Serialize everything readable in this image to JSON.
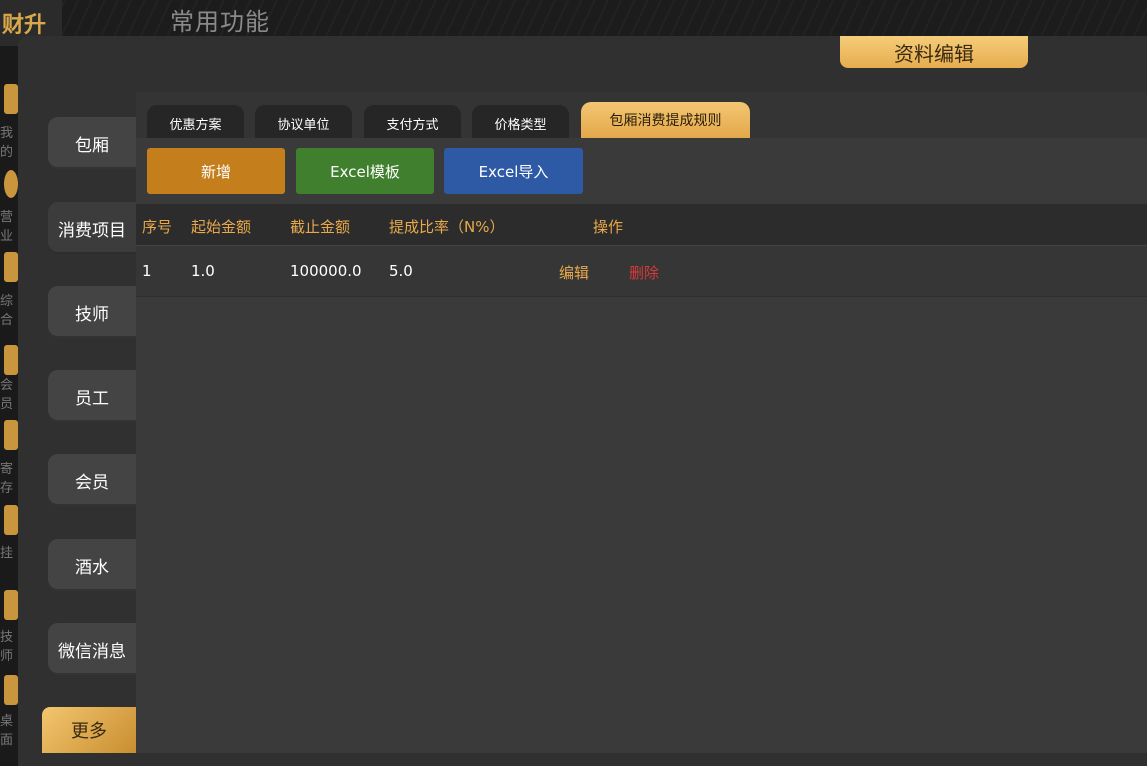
{
  "app": {
    "title": "常用功能",
    "logo_text": "财升",
    "side_fragments": [
      "我的",
      "营业",
      "综合",
      "会员",
      "寄存",
      "挂",
      "技师",
      "桌面"
    ]
  },
  "dialog": {
    "title": "资料编辑"
  },
  "nav": {
    "items": [
      {
        "label": "包厢"
      },
      {
        "label": "消费项目"
      },
      {
        "label": "技师"
      },
      {
        "label": "员工"
      },
      {
        "label": "会员"
      },
      {
        "label": "酒水"
      },
      {
        "label": "微信消息"
      }
    ],
    "more_label": "更多"
  },
  "tabs": [
    {
      "label": "优惠方案"
    },
    {
      "label": "协议单位"
    },
    {
      "label": "支付方式"
    },
    {
      "label": "价格类型"
    },
    {
      "label": "包厢消费提成规则"
    }
  ],
  "active_tab": "包厢消费提成规则",
  "toolbar": {
    "add_label": "新增",
    "template_label": "Excel模板",
    "import_label": "Excel导入"
  },
  "table": {
    "columns": [
      "序号",
      "起始金额",
      "截止金额",
      "提成比率（N%）",
      "操作"
    ],
    "rows": [
      {
        "index": "1",
        "start": "1.0",
        "end": "100000.0",
        "rate": "5.0",
        "edit": "编辑",
        "delete": "删除"
      }
    ]
  },
  "colors": {
    "accent_gold": "#e8a94b",
    "add_button": "#c47f1c",
    "template_button": "#3f7f2d",
    "import_button": "#2e5aa5",
    "delete_red": "#d63a3a"
  }
}
